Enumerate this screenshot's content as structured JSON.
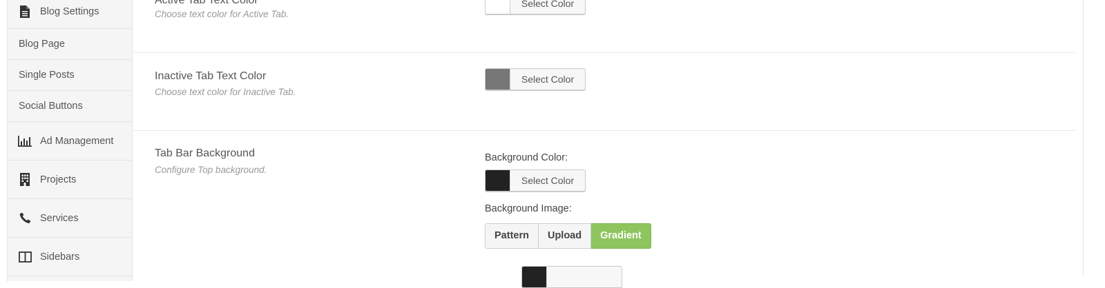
{
  "sidebar": {
    "items": [
      {
        "label": "Blog Settings",
        "icon": "document-icon"
      },
      {
        "label": "Blog Page"
      },
      {
        "label": "Single Posts"
      },
      {
        "label": "Social Buttons"
      },
      {
        "label": "Ad Management",
        "icon": "bar-chart-icon"
      },
      {
        "label": "Projects",
        "icon": "building-icon"
      },
      {
        "label": "Services",
        "icon": "phone-icon"
      },
      {
        "label": "Sidebars",
        "icon": "columns-icon"
      }
    ]
  },
  "settings": {
    "active_tab_text": {
      "title": "Active Tab Text Color",
      "description": "Choose text color for Active Tab.",
      "button_label": "Select Color",
      "swatch_color": "#ffffff"
    },
    "inactive_tab_text": {
      "title": "Inactive Tab Text Color",
      "description": "Choose text color for Inactive Tab.",
      "button_label": "Select Color",
      "swatch_color": "#777777"
    },
    "tab_bar_background": {
      "title": "Tab Bar Background",
      "description": "Configure Top background.",
      "bg_color_label": "Background Color:",
      "button_label": "Select Color",
      "swatch_color": "#222222",
      "bg_image_label": "Background Image:",
      "image_options": [
        "Pattern",
        "Upload",
        "Gradient"
      ],
      "selected_option": "Gradient"
    }
  },
  "colors": {
    "active_green": "#8fc55f",
    "sidebar_bg": "#f5f5f5"
  }
}
